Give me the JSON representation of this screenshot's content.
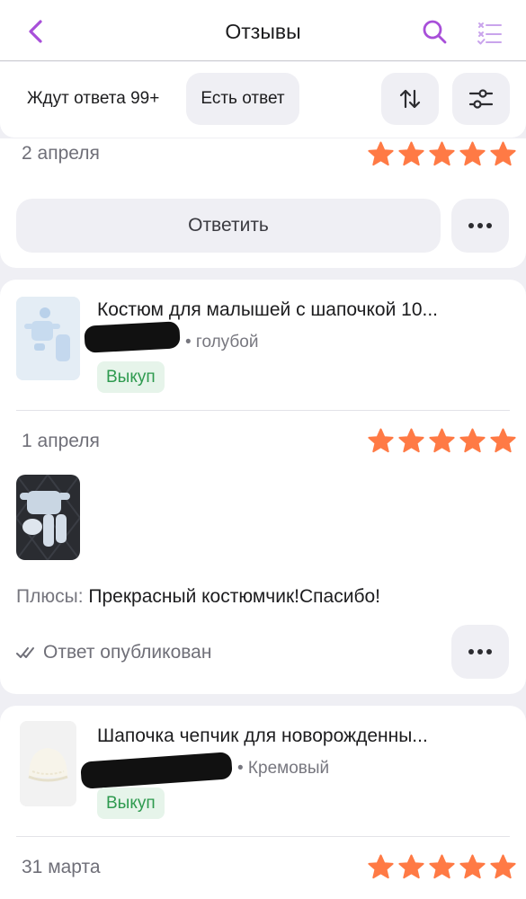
{
  "header": {
    "title": "Отзывы",
    "back_icon": "chevron-left-icon",
    "search_icon": "search-icon",
    "select_icon": "checklist-icon",
    "accent_color": "#a84fd9"
  },
  "filters": {
    "awaiting_label": "Ждут ответа 99+",
    "answered_label": "Есть ответ",
    "sort_icon": "sort-arrows-icon",
    "filter_icon": "sliders-icon"
  },
  "reviews": [
    {
      "date": "2 апреля",
      "rating": 5,
      "reply_label": "Ответить"
    },
    {
      "product_name": "Костюм для малышей с шапочкой 10...",
      "variant": "• голубой",
      "badge": "Выкуп",
      "date": "1 апреля",
      "rating": 5,
      "pros_label": "Плюсы:",
      "pros_text": "Прекрасный костюмчик!Спасибо!",
      "status": "Ответ опубликован"
    },
    {
      "product_name": "Шапочка чепчик для новорожденны...",
      "variant": "• Кремовый",
      "badge": "Выкуп",
      "date": "31 марта",
      "rating": 5
    }
  ],
  "colors": {
    "star": "#ff7a45",
    "badge_text": "#2e9a4f",
    "badge_bg": "#e6f4ea"
  }
}
